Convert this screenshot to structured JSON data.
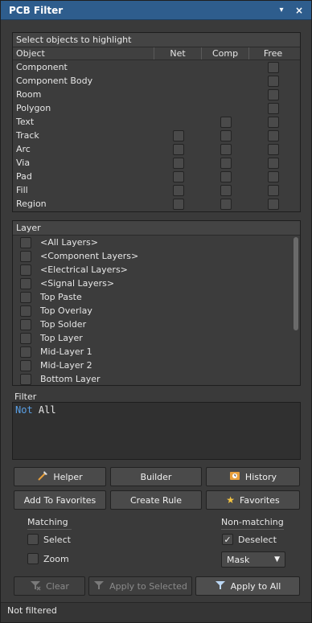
{
  "window": {
    "title": "PCB Filter",
    "pin_glyph": "▾",
    "close_glyph": "×"
  },
  "objects_section": {
    "header": "Select objects to highlight",
    "columns": [
      "Object",
      "Net",
      "Comp",
      "Free"
    ],
    "rows": [
      {
        "label": "Component",
        "net": null,
        "comp": null,
        "free": false
      },
      {
        "label": "Component Body",
        "net": null,
        "comp": null,
        "free": false
      },
      {
        "label": "Room",
        "net": null,
        "comp": null,
        "free": false
      },
      {
        "label": "Polygon",
        "net": null,
        "comp": null,
        "free": false
      },
      {
        "label": "Text",
        "net": null,
        "comp": false,
        "free": false
      },
      {
        "label": "Track",
        "net": false,
        "comp": false,
        "free": false
      },
      {
        "label": "Arc",
        "net": false,
        "comp": false,
        "free": false
      },
      {
        "label": "Via",
        "net": false,
        "comp": false,
        "free": false
      },
      {
        "label": "Pad",
        "net": false,
        "comp": false,
        "free": false
      },
      {
        "label": "Fill",
        "net": false,
        "comp": false,
        "free": false
      },
      {
        "label": "Region",
        "net": false,
        "comp": false,
        "free": false
      }
    ]
  },
  "layer_section": {
    "header": "Layer",
    "items": [
      {
        "label": "<All Layers>",
        "checked": false
      },
      {
        "label": "<Component Layers>",
        "checked": false
      },
      {
        "label": "<Electrical Layers>",
        "checked": false
      },
      {
        "label": "<Signal Layers>",
        "checked": false
      },
      {
        "label": "Top Paste",
        "checked": false
      },
      {
        "label": "Top Overlay",
        "checked": false
      },
      {
        "label": "Top Solder",
        "checked": false
      },
      {
        "label": "Top Layer",
        "checked": false
      },
      {
        "label": "Mid-Layer 1",
        "checked": false
      },
      {
        "label": "Mid-Layer 2",
        "checked": false
      },
      {
        "label": "Bottom Layer",
        "checked": false
      }
    ]
  },
  "filter": {
    "label": "Filter",
    "keyword": "Not",
    "text": " All"
  },
  "buttons": {
    "helper": "Helper",
    "builder": "Builder",
    "history": "History",
    "add_to_favorites": "Add To Favorites",
    "create_rule": "Create Rule",
    "favorites": "Favorites",
    "clear": "Clear",
    "apply_to_selected": "Apply to Selected",
    "apply_to_all": "Apply to All"
  },
  "matching": {
    "label": "Matching",
    "select_label": "Select",
    "select_checked": false,
    "zoom_label": "Zoom",
    "zoom_checked": false
  },
  "non_matching": {
    "label": "Non-matching",
    "deselect_label": "Deselect",
    "deselect_checked": true,
    "mode_value": "Mask"
  },
  "status": {
    "text": "Not filtered"
  },
  "colors": {
    "title_bar": "#2e5d8d",
    "keyword": "#5aa0e6"
  }
}
